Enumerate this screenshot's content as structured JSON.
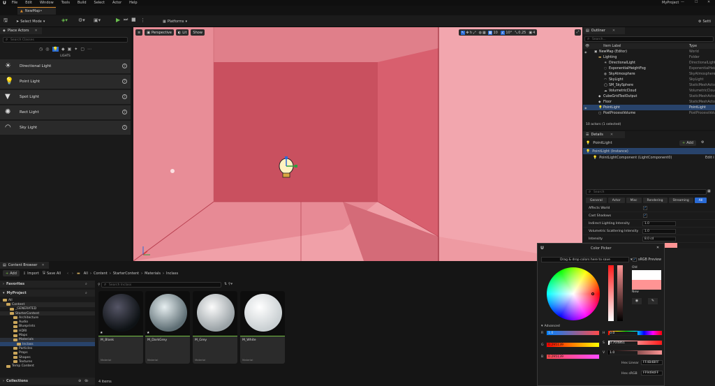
{
  "menu": {
    "items": [
      "File",
      "Edit",
      "Window",
      "Tools",
      "Build",
      "Select",
      "Actor",
      "Help"
    ],
    "project": "MyProject"
  },
  "tab": {
    "label": "NewMap•"
  },
  "toolbar": {
    "select_mode": "Select Mode",
    "platforms": "Platforms",
    "settings": "Setti"
  },
  "place_actors": {
    "title": "Place Actors",
    "search_placeholder": "Search Classes",
    "category": "LIGHTS",
    "items": [
      "Directional Light",
      "Point Light",
      "Spot Light",
      "Rect Light",
      "Sky Light"
    ]
  },
  "viewport": {
    "perspective": "Perspective",
    "lit": "Lit",
    "show": "Show",
    "fov": "10°",
    "speed": "0.25",
    "cam": "4",
    "grid": "10"
  },
  "outliner": {
    "title": "Outliner",
    "search_placeholder": "Search...",
    "col_label": "Item Label",
    "col_type": "Type",
    "rows": [
      {
        "label": "NewMap (Editor)",
        "type": "World"
      },
      {
        "label": "Lighting",
        "type": "Folder"
      },
      {
        "label": "DirectionalLight",
        "type": "DirectionalLight"
      },
      {
        "label": "ExponentialHeightFog",
        "type": "ExponentialHeig"
      },
      {
        "label": "SkyAtmosphere",
        "type": "SkyAtmosphere"
      },
      {
        "label": "SkyLight",
        "type": "SkyLight"
      },
      {
        "label": "SM_SkySphere",
        "type": "StaticMeshActo"
      },
      {
        "label": "VolumetricCloud",
        "type": "VolumetricCloud"
      },
      {
        "label": "CubeGridToolOutput",
        "type": "StaticMeshActo"
      },
      {
        "label": "Floor",
        "type": "StaticMeshActo"
      },
      {
        "label": "PointLight",
        "type": "PointLight"
      },
      {
        "label": "PostProcessVolume",
        "type": "PostProcessVolu"
      }
    ],
    "status": "10 actors (1 selected)"
  },
  "details": {
    "title": "Details",
    "actor_name": "PointLight",
    "add_label": "Add",
    "instance_label": "PointLight (Instance)",
    "component_label": "PointLightComponent (LightComponent0)",
    "edit_label": "Edit i",
    "search_placeholder": "Search",
    "tabs": [
      "General",
      "Actor",
      "Misc",
      "Rendering",
      "Streaming",
      "All"
    ],
    "props": [
      {
        "name": "Affects World",
        "value": "✓"
      },
      {
        "name": "Cast Shadows",
        "value": "✓"
      },
      {
        "name": "Indirect Lighting Intensity",
        "value": "1.0"
      },
      {
        "name": "Volumetric Scattering Intensity",
        "value": "1.0"
      },
      {
        "name": "Intensity",
        "value": "8.0 cd"
      }
    ]
  },
  "content_browser": {
    "title": "Content Browser",
    "add_label": "Add",
    "import_label": "Import",
    "save_all_label": "Save All",
    "breadcrumb": [
      "All",
      "Content",
      "StarterContent",
      "Materials",
      "Inclass"
    ],
    "favorites": "Favorites",
    "project": "MyProject",
    "search_placeholder": "Search Inclass",
    "tree": [
      {
        "label": "All",
        "level": 0
      },
      {
        "label": "Content",
        "level": 1
      },
      {
        "label": "_GENERATED",
        "level": 2
      },
      {
        "label": "StarterContent",
        "level": 2
      },
      {
        "label": "Architecture",
        "level": 3
      },
      {
        "label": "Audio",
        "level": 3
      },
      {
        "label": "Blueprints",
        "level": 3
      },
      {
        "label": "HDRI",
        "level": 3
      },
      {
        "label": "Maps",
        "level": 3
      },
      {
        "label": "Materials",
        "level": 3
      },
      {
        "label": "Inclass",
        "level": 4
      },
      {
        "label": "Particles",
        "level": 3
      },
      {
        "label": "Props",
        "level": 3
      },
      {
        "label": "Shapes",
        "level": 3
      },
      {
        "label": "Textures",
        "level": 3
      },
      {
        "label": "Temp Content",
        "level": 1
      }
    ],
    "assets": [
      {
        "name": "M_Blank",
        "type": "Material"
      },
      {
        "name": "M_DarkGrey",
        "type": "Material"
      },
      {
        "name": "M_Grey",
        "type": "Material"
      },
      {
        "name": "M_White",
        "type": "Material"
      }
    ],
    "collections": "Collections",
    "count": "4 items"
  },
  "color_picker": {
    "title": "Color Picker",
    "drag_hint": "Drag & drop colors here to save",
    "srgb_label": "sRGB Preview",
    "old_label": "Old",
    "new_label": "New",
    "advanced_label": "Advanced",
    "r": "1.0",
    "g": "0.295139",
    "b": "0.295139",
    "h": "0.0",
    "s": "0.704861",
    "v": "1.0",
    "hex_linear_label": "Hex Linear",
    "hex_linear": "FF4B4BFF",
    "hex_srgb_label": "Hex sRGB",
    "hex_srgb": "FF9494FF",
    "old_color": "#ffffff",
    "new_color": "#ff9494"
  },
  "colors": {
    "accent": "#2a6bd6",
    "selection": "#28436b",
    "green": "#76c043",
    "room": "#e8848e"
  }
}
